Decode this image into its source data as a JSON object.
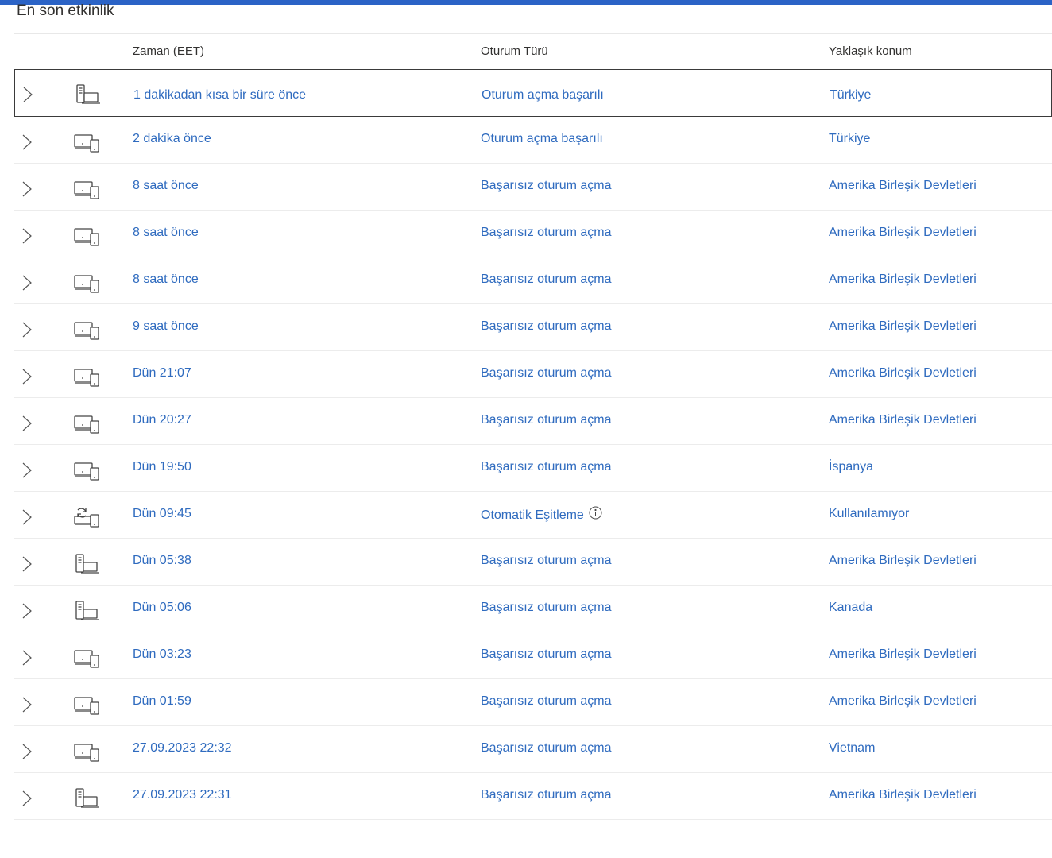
{
  "page": {
    "title": "En son etkinlik"
  },
  "table": {
    "columns": {
      "time": "Zaman (EET)",
      "type": "Oturum Türü",
      "location": "Yaklaşık konum"
    },
    "rows": [
      {
        "time": "1 dakikadan kısa bir süre önce",
        "type": "Oturum açma başarılı",
        "location": "Türkiye",
        "device": "desktop-laptop-icon"
      },
      {
        "time": "2 dakika önce",
        "type": "Oturum açma başarılı",
        "location": "Türkiye",
        "device": "laptop-phone-icon"
      },
      {
        "time": "8 saat önce",
        "type": "Başarısız oturum açma",
        "location": "Amerika Birleşik Devletleri",
        "device": "laptop-phone-icon"
      },
      {
        "time": "8 saat önce",
        "type": "Başarısız oturum açma",
        "location": "Amerika Birleşik Devletleri",
        "device": "laptop-phone-icon"
      },
      {
        "time": "8 saat önce",
        "type": "Başarısız oturum açma",
        "location": "Amerika Birleşik Devletleri",
        "device": "laptop-phone-icon"
      },
      {
        "time": "9 saat önce",
        "type": "Başarısız oturum açma",
        "location": "Amerika Birleşik Devletleri",
        "device": "laptop-phone-icon"
      },
      {
        "time": "Dün 21:07",
        "type": "Başarısız oturum açma",
        "location": "Amerika Birleşik Devletleri",
        "device": "laptop-phone-icon"
      },
      {
        "time": "Dün 20:27",
        "type": "Başarısız oturum açma",
        "location": "Amerika Birleşik Devletleri",
        "device": "laptop-phone-icon"
      },
      {
        "time": "Dün 19:50",
        "type": "Başarısız oturum açma",
        "location": "İspanya",
        "device": "laptop-phone-icon"
      },
      {
        "time": "Dün 09:45",
        "type": "Otomatik Eşitleme",
        "location": "Kullanılamıyor",
        "device": "sync-devices-icon",
        "info": true
      },
      {
        "time": "Dün 05:38",
        "type": "Başarısız oturum açma",
        "location": "Amerika Birleşik Devletleri",
        "device": "desktop-laptop-icon"
      },
      {
        "time": "Dün 05:06",
        "type": "Başarısız oturum açma",
        "location": "Kanada",
        "device": "desktop-laptop-icon"
      },
      {
        "time": "Dün 03:23",
        "type": "Başarısız oturum açma",
        "location": "Amerika Birleşik Devletleri",
        "device": "laptop-phone-icon"
      },
      {
        "time": "Dün 01:59",
        "type": "Başarısız oturum açma",
        "location": "Amerika Birleşik Devletleri",
        "device": "laptop-phone-icon"
      },
      {
        "time": "27.09.2023 22:32",
        "type": "Başarısız oturum açma",
        "location": "Vietnam",
        "device": "laptop-phone-icon"
      },
      {
        "time": "27.09.2023 22:31",
        "type": "Başarısız oturum açma",
        "location": "Amerika Birleşik Devletleri",
        "device": "desktop-laptop-icon"
      }
    ]
  },
  "colors": {
    "link": "#2f6bbf",
    "text": "#323130",
    "accent_bar": "#2b63c6"
  }
}
